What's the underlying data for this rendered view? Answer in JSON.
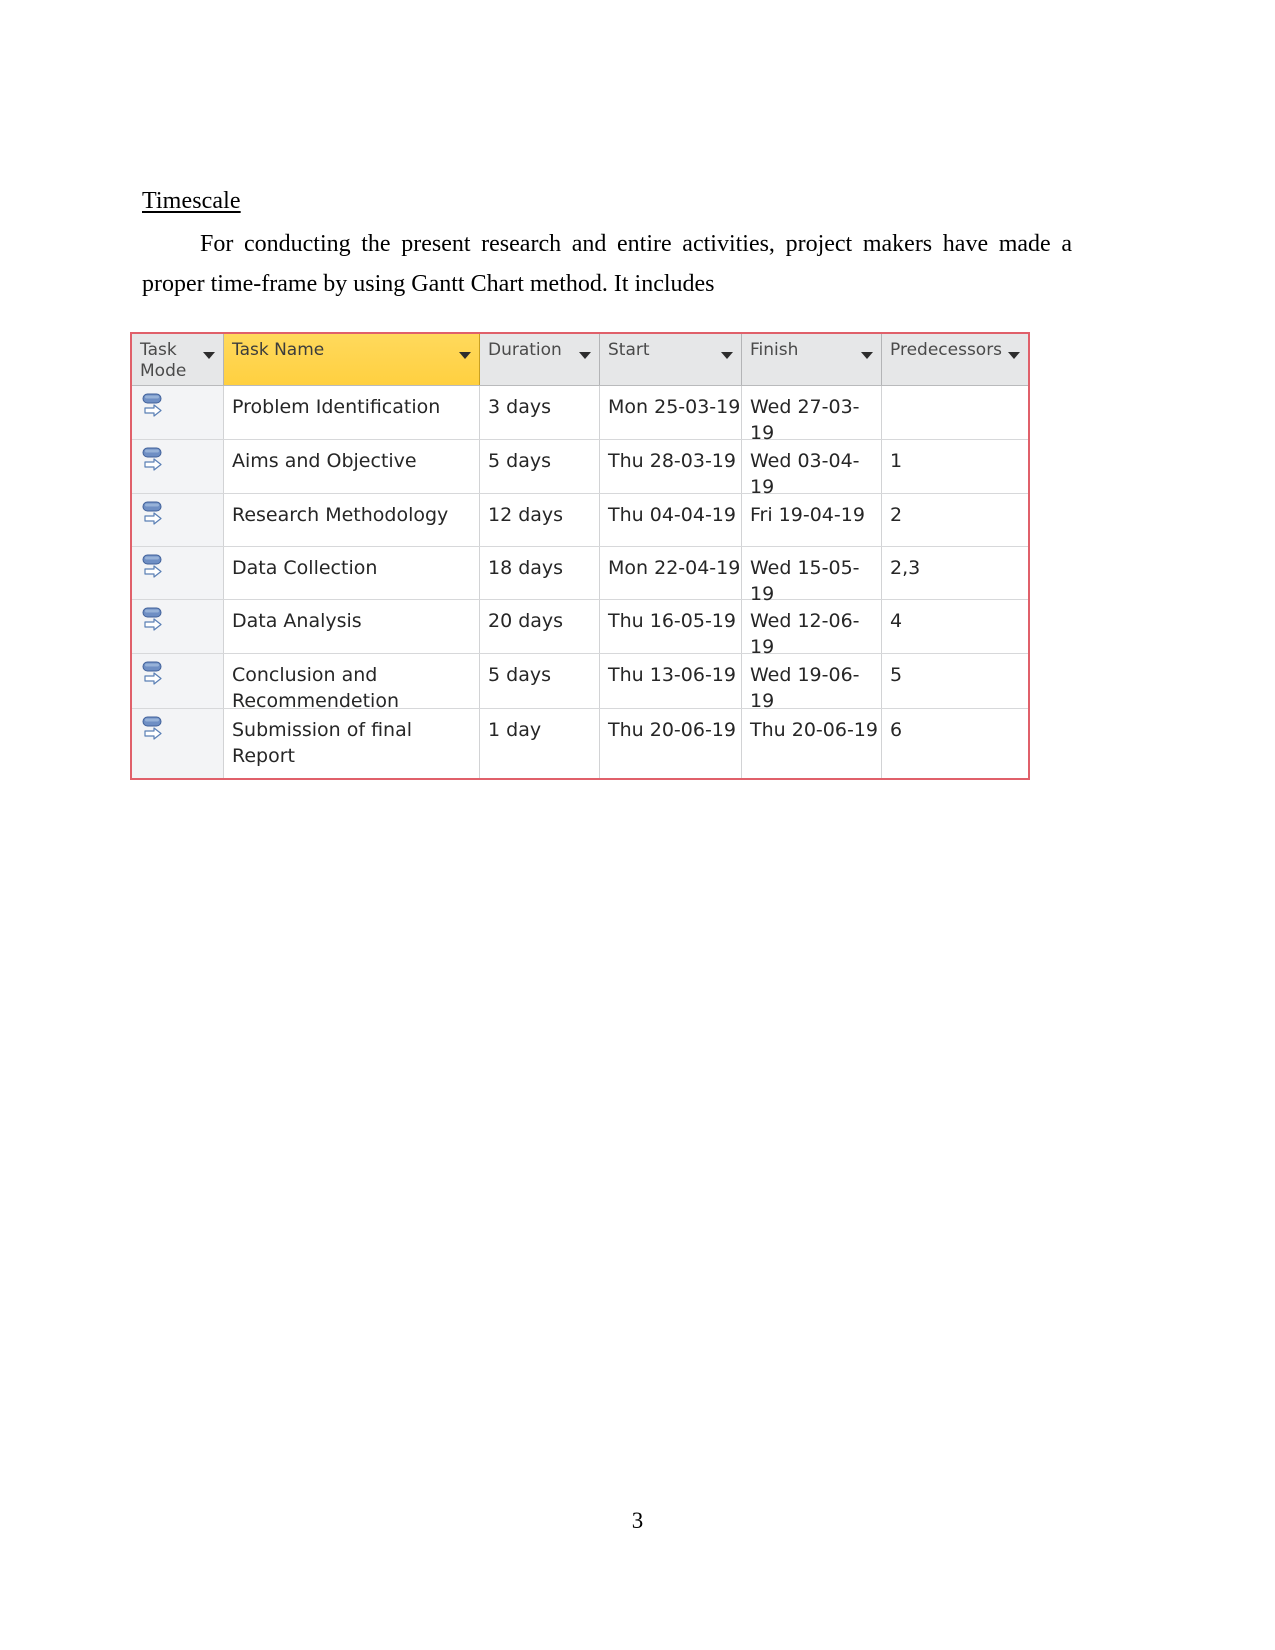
{
  "document": {
    "heading": "Timescale",
    "paragraph": "For conducting the present research and entire activities, project makers have made a proper time-frame by using Gantt Chart method. It includes",
    "page_number": "3"
  },
  "project_table": {
    "border_color": "#e0606a",
    "highlight_color": "#ffd040",
    "columns": [
      {
        "key": "task_mode",
        "label": "Task\nMode",
        "has_caret": true,
        "highlighted": false
      },
      {
        "key": "task_name",
        "label": "Task Name",
        "has_caret": true,
        "highlighted": true
      },
      {
        "key": "duration",
        "label": "Duration",
        "has_caret": true,
        "highlighted": false
      },
      {
        "key": "start",
        "label": "Start",
        "has_caret": true,
        "highlighted": false
      },
      {
        "key": "finish",
        "label": "Finish",
        "has_caret": true,
        "highlighted": false
      },
      {
        "key": "predecessors",
        "label": "Predecessors",
        "has_caret": true,
        "highlighted": false
      }
    ],
    "caret_icon": "chevron-down-icon",
    "task_mode_icon": "auto-scheduled-icon",
    "rows": [
      {
        "task_mode": "auto-scheduled-icon",
        "task_name": "Problem Identification",
        "duration": "3 days",
        "start": "Mon 25-03-19",
        "finish": "Wed 27-03-19",
        "predecessors": ""
      },
      {
        "task_mode": "auto-scheduled-icon",
        "task_name": "Aims and Objective",
        "duration": "5 days",
        "start": "Thu 28-03-19",
        "finish": "Wed 03-04-19",
        "predecessors": "1"
      },
      {
        "task_mode": "auto-scheduled-icon",
        "task_name": "Research Methodology",
        "duration": "12 days",
        "start": "Thu 04-04-19",
        "finish": "Fri 19-04-19",
        "predecessors": "2"
      },
      {
        "task_mode": "auto-scheduled-icon",
        "task_name": "Data Collection",
        "duration": "18 days",
        "start": "Mon 22-04-19",
        "finish": "Wed 15-05-19",
        "predecessors": "2,3"
      },
      {
        "task_mode": "auto-scheduled-icon",
        "task_name": "Data Analysis",
        "duration": "20 days",
        "start": "Thu 16-05-19",
        "finish": "Wed 12-06-19",
        "predecessors": "4"
      },
      {
        "task_mode": "auto-scheduled-icon",
        "task_name": "Conclusion and Recommendetion",
        "duration": "5 days",
        "start": "Thu 13-06-19",
        "finish": "Wed 19-06-19",
        "predecessors": "5"
      },
      {
        "task_mode": "auto-scheduled-icon",
        "task_name": "Submission of final Report",
        "duration": "1 day",
        "start": "Thu 20-06-19",
        "finish": "Thu 20-06-19",
        "predecessors": "6"
      }
    ]
  }
}
